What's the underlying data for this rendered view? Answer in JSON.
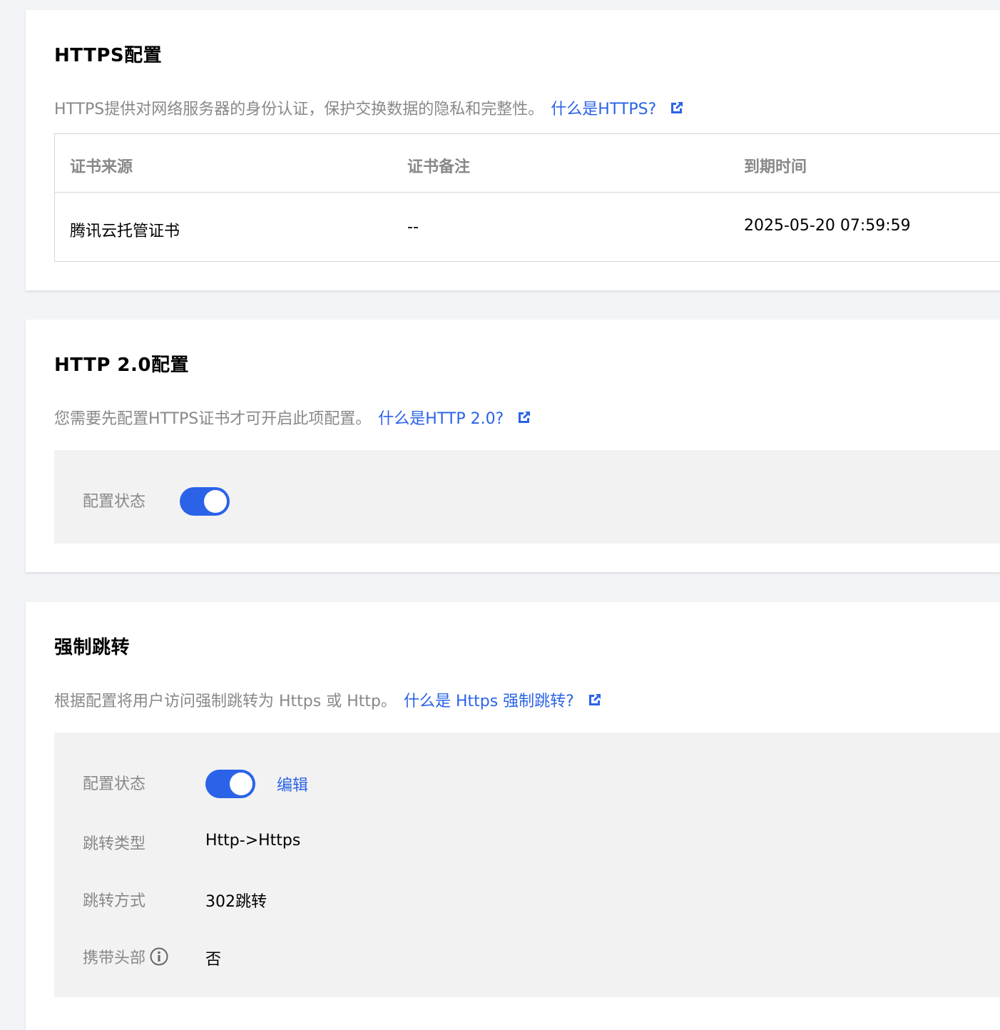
{
  "https": {
    "title": "HTTPS配置",
    "description": "HTTPS提供对网络服务器的身份认证，保护交换数据的隐私和完整性。",
    "help_link": "什么是HTTPS?",
    "table": {
      "columns": [
        "证书来源",
        "证书备注",
        "到期时间"
      ],
      "rows": [
        [
          "腾讯云托管证书",
          "--",
          "2025-05-20 07:59:59"
        ]
      ]
    }
  },
  "http2": {
    "title": "HTTP 2.0配置",
    "description": "您需要先配置HTTPS证书才可开启此项配置。",
    "help_link": "什么是HTTP 2.0?",
    "status_label": "配置状态",
    "status_enabled": true
  },
  "redirect": {
    "title": "强制跳转",
    "description": "根据配置将用户访问强制跳转为 Https 或 Http。",
    "help_link": "什么是 Https 强制跳转?",
    "status_label": "配置状态",
    "status_enabled": true,
    "edit_label": "编辑",
    "type_label": "跳转类型",
    "type_value": "Http->Https",
    "method_label": "跳转方式",
    "method_value": "302跳转",
    "header_label": "携带头部",
    "header_value": "否"
  },
  "colors": {
    "accent": "#2a63e8",
    "muted_text": "#888888",
    "panel_bg": "#f2f2f2",
    "page_bg": "#f3f4f7"
  },
  "icons": {
    "external_link": "external-link-icon",
    "info": "info-icon"
  }
}
